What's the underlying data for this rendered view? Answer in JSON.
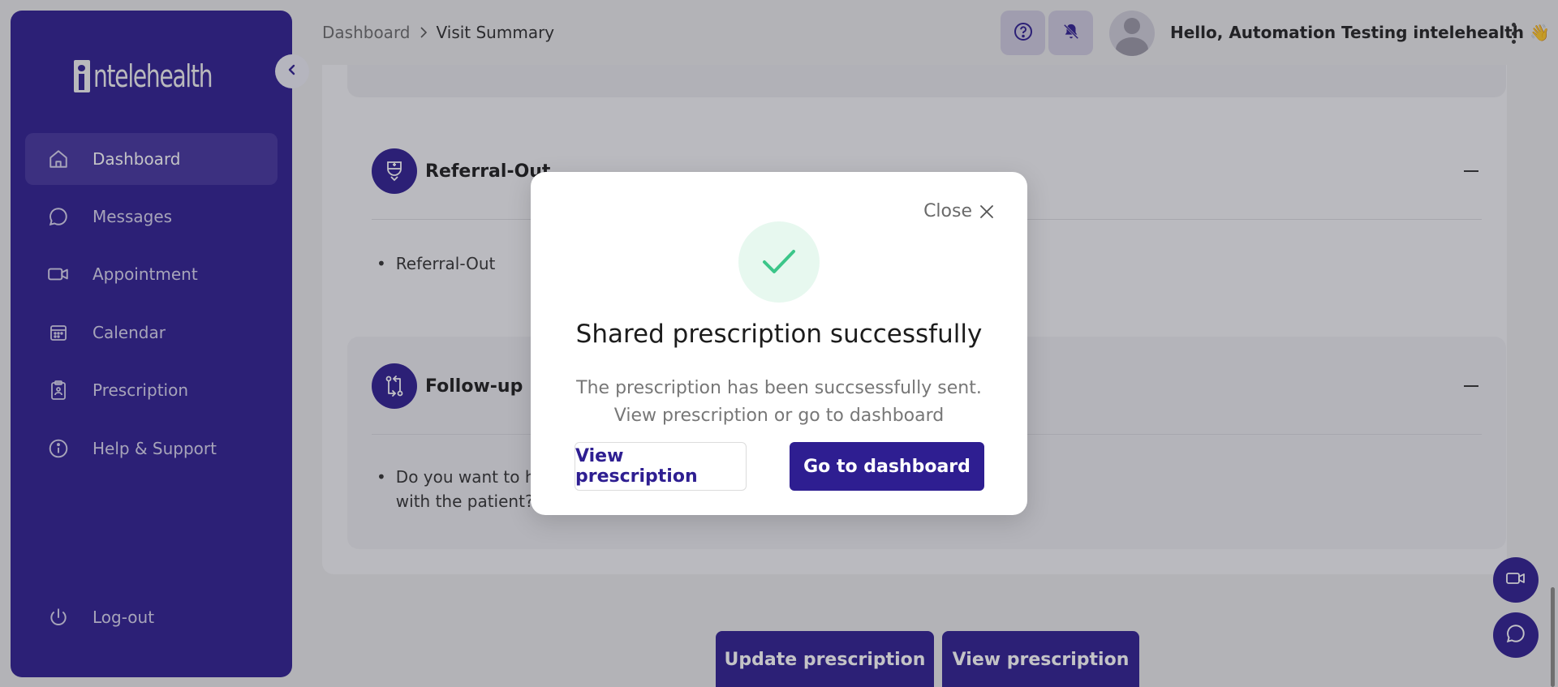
{
  "brand": {
    "logo_text": "ntelehealth"
  },
  "sidebar": {
    "items": [
      {
        "label": "Dashboard",
        "icon": "home-icon"
      },
      {
        "label": "Messages",
        "icon": "chat-icon"
      },
      {
        "label": "Appointment",
        "icon": "video-icon"
      },
      {
        "label": "Calendar",
        "icon": "calendar-icon"
      },
      {
        "label": "Prescription",
        "icon": "clipboard-icon"
      },
      {
        "label": "Help & Support",
        "icon": "info-icon"
      }
    ],
    "logout_label": "Log-out"
  },
  "header": {
    "breadcrumb": {
      "root": "Dashboard",
      "separator": ">",
      "current": "Visit Summary"
    },
    "greeting": "Hello, Automation Testing intelehealth 👋"
  },
  "sections": {
    "referral": {
      "title": "Referral-Out",
      "items": [
        "Referral-Out"
      ]
    },
    "followup": {
      "title": "Follow-up",
      "item_line1": "Do you want to ha",
      "item_line2": "with the patient?"
    }
  },
  "footer": {
    "update_label": "Update prescription",
    "view_label": "View prescription"
  },
  "modal": {
    "close_label": "Close",
    "title": "Shared prescription successfully",
    "message": "The prescription has been succsessfully sent. View prescription or go to dashboard",
    "view_button": "View prescription",
    "dashboard_button": "Go to dashboard"
  },
  "colors": {
    "primary": "#2E1E91",
    "success": "#3CC689",
    "success_bg": "#E7F8EF"
  }
}
